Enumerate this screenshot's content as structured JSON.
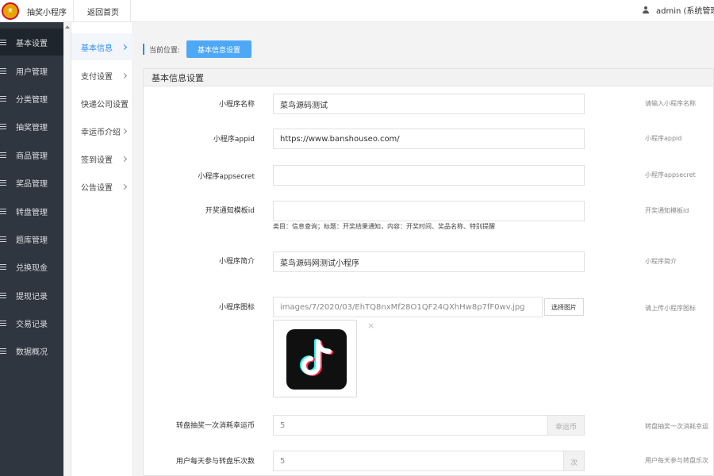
{
  "header": {
    "brand": "抽奖小程序",
    "back_home": "返回首页",
    "user": "admin (系统管理"
  },
  "sidebar": {
    "items": [
      {
        "label": "基本设置",
        "active": true
      },
      {
        "label": "用户管理"
      },
      {
        "label": "分类管理"
      },
      {
        "label": "抽奖管理"
      },
      {
        "label": "商品管理"
      },
      {
        "label": "奖品管理"
      },
      {
        "label": "转盘管理"
      },
      {
        "label": "题库管理"
      },
      {
        "label": "兑换现金"
      },
      {
        "label": "提现记录"
      },
      {
        "label": "交易记录"
      },
      {
        "label": "数据概况"
      }
    ]
  },
  "subnav": {
    "items": [
      {
        "label": "基本信息",
        "active": true,
        "arrow": true
      },
      {
        "label": "支付设置",
        "arrow": true
      },
      {
        "label": "快递公司设置",
        "arrow": false
      },
      {
        "label": "幸运币介绍",
        "arrow": true
      },
      {
        "label": "签到设置",
        "arrow": true
      },
      {
        "label": "公告设置",
        "arrow": true
      }
    ]
  },
  "breadcrumb": {
    "label": "当前位置:",
    "current": "基本信息设置"
  },
  "panel": {
    "title": "基本信息设置",
    "fields": {
      "name": {
        "label": "小程序名称",
        "value": "菜鸟源码测试",
        "help": "请输入小程序名称"
      },
      "appid": {
        "label": "小程序appid",
        "value": "https://www.banshouseo.com/",
        "help": "小程序appid"
      },
      "appsecret": {
        "label": "小程序appsecret",
        "value": "",
        "help": "小程序appsecret"
      },
      "template": {
        "label": "开奖通知模板id",
        "value": "",
        "help": "开奖通知模板id",
        "note": "类目：信息查询；标题：开奖结果通知，内容：开奖时间、奖品名称、特别提醒"
      },
      "intro": {
        "label": "小程序简介",
        "value": "菜鸟源码网测试小程序",
        "help": "小程序简介"
      },
      "icon": {
        "label": "小程序图标",
        "value": "images/7/2020/03/EhTQ8nxMf28O1QF24QXhHw8p7fF0wv.jpg",
        "button": "选择图片",
        "help": "请上传小程序图标",
        "close": "×"
      },
      "spin_cost": {
        "label": "转盘抽奖一次消耗幸运币",
        "value": "5",
        "unit": "幸运币",
        "help": "转盘抽奖一次消耗幸运"
      },
      "daily_limit": {
        "label": "用户每天参与转盘乐次数",
        "value": "5",
        "unit": "次",
        "help": "用户每天参与转盘乐次"
      }
    }
  },
  "colors": {
    "sidebar_bg": "#2f3640",
    "accent": "#2d8cf0",
    "tag_bg": "#4ea8f5",
    "logo": "#e8a400"
  }
}
